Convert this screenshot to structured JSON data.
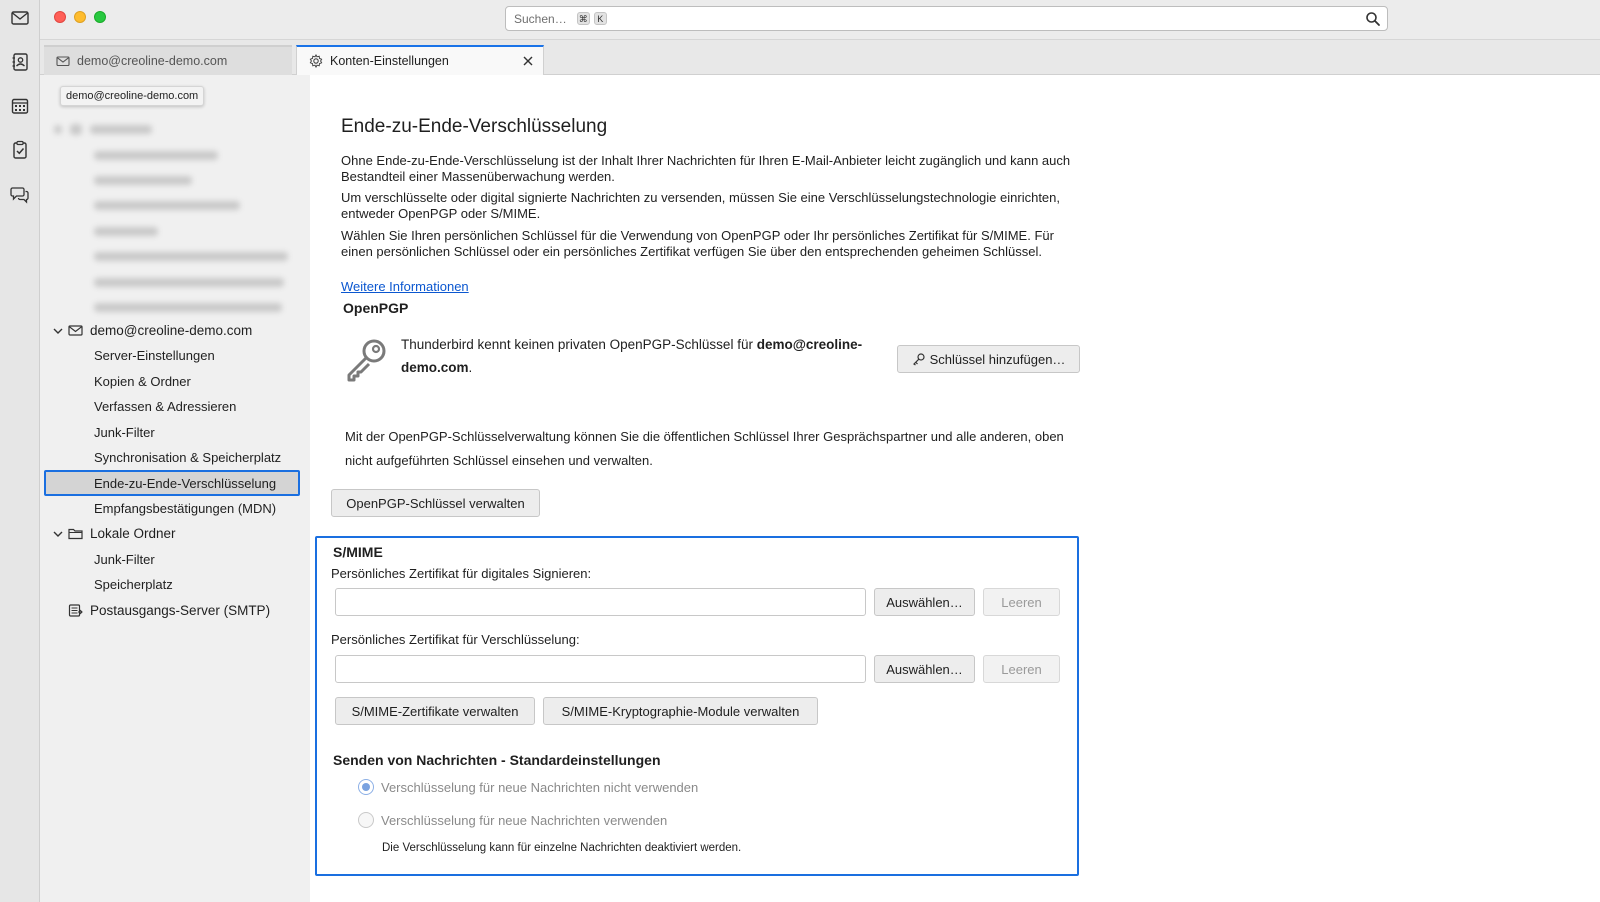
{
  "search": {
    "placeholder": "Suchen…",
    "kbd1": "⌘",
    "kbd2": "K"
  },
  "tabs": [
    {
      "label": "demo@creoline-demo.com"
    },
    {
      "label": "Konten-Einstellungen"
    }
  ],
  "sidebar": {
    "tooltip": "demo@creoline-demo.com",
    "account": "demo@creoline-demo.com",
    "items": [
      "Server-Einstellungen",
      "Kopien & Ordner",
      "Verfassen & Adressieren",
      "Junk-Filter",
      "Synchronisation & Speicherplatz",
      "Ende-zu-Ende-Verschlüsselung",
      "Empfangsbestätigungen (MDN)"
    ],
    "local_folders": "Lokale Ordner",
    "local_items": [
      "Junk-Filter",
      "Speicherplatz"
    ],
    "smtp": "Postausgangs-Server (SMTP)"
  },
  "main": {
    "title": "Ende-zu-Ende-Verschlüsselung",
    "para1": "Ohne Ende-zu-Ende-Verschlüsselung ist der Inhalt Ihrer Nachrichten für Ihren E-Mail-Anbieter leicht zugänglich und kann auch Bestandteil einer Massenüberwachung werden.",
    "para2": "Um verschlüsselte oder digital signierte Nachrichten zu versenden, müssen Sie eine Verschlüsselungstechnologie einrichten, entweder OpenPGP oder S/MIME.",
    "para3": "Wählen Sie Ihren persönlichen Schlüssel für die Verwendung von OpenPGP oder Ihr persönliches Zertifikat für S/MIME. Für einen persönlichen Schlüssel oder ein persönliches Zertifikat verfügen Sie über den entsprechenden geheimen Schlüssel.",
    "more_info": "Weitere Informationen",
    "openpgp": {
      "heading": "OpenPGP",
      "status_prefix": "Thunderbird kennt keinen privaten OpenPGP-Schlüssel für ",
      "status_account": "demo@creoline-demo.com",
      "status_suffix": ".",
      "add_key": "Schlüssel hinzufügen…",
      "manager_text": "Mit der OpenPGP-Schlüsselverwaltung können Sie die öffentlichen Schlüssel Ihrer Gesprächspartner und alle anderen, oben nicht aufgeführten Schlüssel einsehen und verwalten.",
      "manage_keys": "OpenPGP-Schlüssel verwalten"
    },
    "smime": {
      "heading": "S/MIME",
      "sign_label": "Persönliches Zertifikat für digitales Signieren:",
      "sign_value": "",
      "encrypt_label": "Persönliches Zertifikat für Verschlüsselung:",
      "encrypt_value": "",
      "select": "Auswählen…",
      "clear": "Leeren",
      "manage_certs": "S/MIME-Zertifikate verwalten",
      "manage_modules": "S/MIME-Kryptographie-Module verwalten",
      "defaults_heading": "Senden von Nachrichten - Standardeinstellungen",
      "radio_off": "Verschlüsselung für neue Nachrichten nicht verwenden",
      "radio_on": "Verschlüsselung für neue Nachrichten verwenden",
      "note": "Die Verschlüsselung kann für einzelne Nachrichten deaktiviert werden."
    }
  },
  "colors": {
    "accent": "#1a6fe0",
    "link": "#0b57d0"
  }
}
